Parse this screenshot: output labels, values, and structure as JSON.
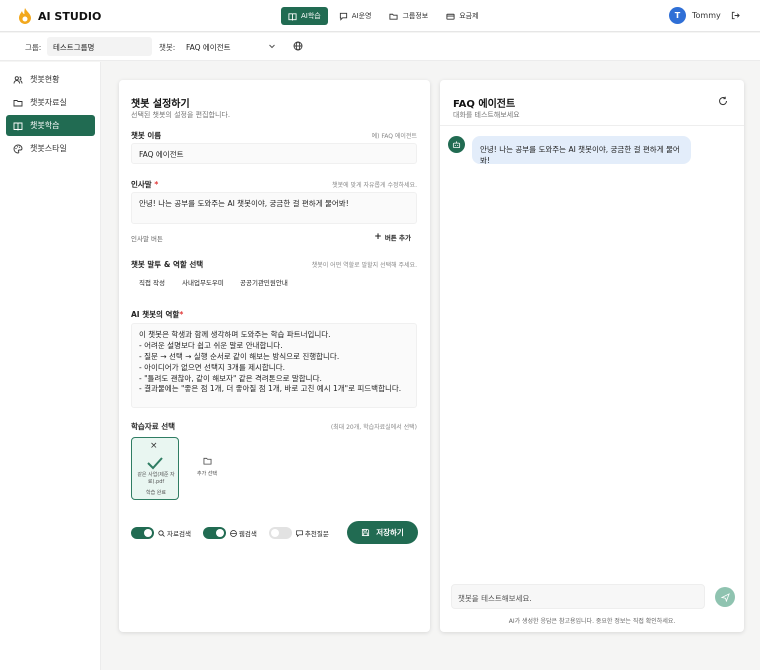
{
  "app": {
    "name": "AI STUDIO"
  },
  "nav": {
    "items": [
      {
        "label": "AI학습",
        "icon": "book-icon",
        "active": true
      },
      {
        "label": "AI운영",
        "icon": "chat-settings-icon",
        "active": false
      },
      {
        "label": "그룹정보",
        "icon": "folder-icon",
        "active": false
      },
      {
        "label": "요금제",
        "icon": "card-icon",
        "active": false
      }
    ]
  },
  "user": {
    "initial": "T",
    "name": "Tommy"
  },
  "filters": {
    "group_label": "그룹:",
    "group_value": "테스트그룹명",
    "bot_label": "챗봇:",
    "bot_value": "FAQ 에이전트"
  },
  "sidebar": {
    "items": [
      {
        "label": "챗봇현황",
        "icon": "users-icon",
        "active": false
      },
      {
        "label": "챗봇자료실",
        "icon": "folder-icon",
        "active": false
      },
      {
        "label": "챗봇학습",
        "icon": "book-icon",
        "active": true
      },
      {
        "label": "챗봇스타일",
        "icon": "palette-icon",
        "active": false
      }
    ]
  },
  "settings": {
    "title": "챗봇 설정하기",
    "subtitle": "선택된 챗봇의 설정을 편집합니다.",
    "name_label": "챗봇 이름",
    "name_hint": "예) FAQ 에이전트",
    "name_value": "FAQ 에이전트",
    "greeting_label": "인사말",
    "greeting_required": "*",
    "greeting_hint": "챗봇에 맞게 자유롭게 수정하세요.",
    "greeting_value": "안녕! 나는 공부를 도와주는 AI 챗봇이야, 궁금한 걸 편하게 물어봐!",
    "greeting_button_label": "인사말 버튼",
    "add_button_label": "버튼 추가",
    "tone_label": "챗봇 말투 & 역할 선택",
    "tone_hint": "챗봇이 어떤 역할로 말할지 선택해 주세요.",
    "tone_chips": [
      "직접 작성",
      "사내업무도우미",
      "공공기관민원안내"
    ],
    "role_label": "AI 챗봇의 역할",
    "role_required": "*",
    "role_text": "이 챗봇은 학생과 함께 생각하며 도와주는 학습 파트너입니다.\n- 어려운 설명보다 쉽고 쉬운 말로 안내합니다.\n- 질문 → 선택 → 실행 순서로 같이 해보는 방식으로 진행합니다.\n- 아이디어가 없으면 선택지 3개를 제시합니다.\n- \"틀려도 괜찮아, 같이 해보자\" 같은 격려톤으로 말합니다.\n- 결과물에는 \"좋은 점 1개, 더 좋아질 점 1개, 바로 고친 예시 1개\"로 피드백합니다.",
    "materials_label": "학습자료 선택",
    "materials_hint": "(최대 20개, 학습자료실에서 선택)",
    "material": {
      "name": "같은 사업(제준 자료).pdf",
      "status": "학습 완료"
    },
    "add_material_label": "추가 선택",
    "toggles": [
      {
        "label": "자료검색",
        "icon": "search-icon",
        "on": true
      },
      {
        "label": "웹검색",
        "icon": "globe-icon",
        "on": true
      },
      {
        "label": "추천질문",
        "icon": "chat-icon",
        "on": false
      }
    ],
    "save_label": "저장하기"
  },
  "chat": {
    "title": "FAQ 에이전트",
    "subtitle": "대화를 테스트해보세요",
    "bot_message": "안녕! 나는 공부를 도와주는 AI 챗봇이야, 궁금한 걸 편하게 물어봐!",
    "input_placeholder": "챗봇을 테스트해보세요.",
    "disclaimer": "AI가 생성한 응답은 참고용입니다. 중요한 정보는 직접 확인하세요."
  },
  "colors": {
    "accent": "#216b52",
    "bubble": "#e3edfa",
    "avatar": "#2f6fd6"
  }
}
